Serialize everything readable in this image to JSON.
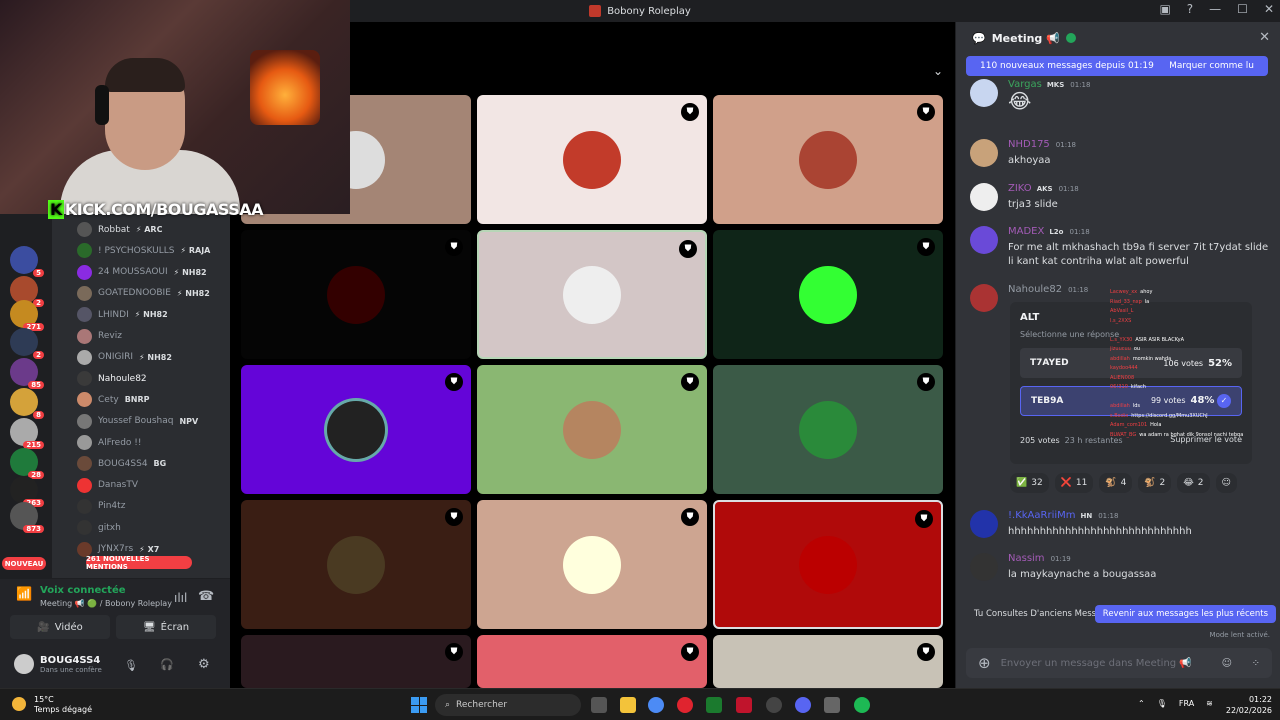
{
  "window": {
    "title": "Bobony Roleplay"
  },
  "overlay_text": {
    "kick": "KICK.COM/BOUGASSAA",
    "kick_letter": "K"
  },
  "servers": {
    "badges": [
      "5",
      "2",
      "271",
      "2",
      "85",
      "8",
      "215",
      "28",
      "263",
      "873"
    ],
    "nouveau": "NOUVEAU"
  },
  "members": [
    {
      "name": "Robbat",
      "tag": "⚡ ARC",
      "color": "#dbdee1"
    },
    {
      "name": "! PSYCHOSKULLS",
      "tag": "⚡ RAJA",
      "color": "#949ba4"
    },
    {
      "name": "24 MOUSSAOUI",
      "tag": "⚡ NH82",
      "color": "#949ba4"
    },
    {
      "name": "GOATEDNOOBIE",
      "tag": "⚡ NH82",
      "color": "#949ba4"
    },
    {
      "name": "LHINDI",
      "tag": "⚡ NH82",
      "color": "#949ba4"
    },
    {
      "name": "Reviz",
      "tag": "",
      "color": "#949ba4"
    },
    {
      "name": "ONIGIRI",
      "tag": "⚡ NH82",
      "color": "#949ba4"
    },
    {
      "name": "Nahoule82",
      "tag": "",
      "color": "#f2f3f5"
    },
    {
      "name": "Cety",
      "tag": "BNRP",
      "color": "#949ba4"
    },
    {
      "name": "Youssef Boushaq",
      "tag": "NPV",
      "color": "#949ba4"
    },
    {
      "name": "AlFredo !!",
      "tag": "",
      "color": "#949ba4"
    },
    {
      "name": "BOUG4SS4",
      "tag": "BG",
      "color": "#949ba4"
    },
    {
      "name": "DanasTV",
      "tag": "",
      "color": "#949ba4"
    },
    {
      "name": "Pin4tz",
      "tag": "",
      "color": "#949ba4"
    },
    {
      "name": "gitxh",
      "tag": "",
      "color": "#949ba4"
    },
    {
      "name": "JYNX7rs",
      "tag": "⚡ X7",
      "color": "#949ba4"
    }
  ],
  "mentions": "261 NOUVELLES MENTIONS",
  "voice": {
    "status": "Voix connectée",
    "channel": "Meeting 📢 🟢 / Bobony Roleplay",
    "video_label": "Vidéo",
    "screen_label": "Écran",
    "user_name": "BOUG4SS4",
    "user_status": "Dans une confère"
  },
  "tiles_colors": [
    "#a48575",
    "#f2e6e4",
    "#d0a08a",
    "#050505",
    "#d3c6c6",
    "#0f2518",
    "#6405d8",
    "#8ab772",
    "#3b5a47",
    "#3a1e14",
    "#cda591",
    "#b00a0a",
    "#2a1a1f",
    "#e2606a",
    "#c8c2b6"
  ],
  "chat": {
    "channel": "Meeting 📢",
    "new_messages": "110 nouveaux messages depuis 01:19",
    "mark_read": "Marquer comme lu",
    "messages": [
      {
        "author": "Vargas",
        "badge": "MKS",
        "time": "01:18",
        "text": "😂",
        "color": "#3ba55d"
      },
      {
        "author": "NHD175",
        "badge": "",
        "time": "01:18",
        "text": "akhoyaa",
        "color": "#a35bb6"
      },
      {
        "author": "ZIKO",
        "badge": "AKS",
        "time": "01:18",
        "text": "trja3 slide",
        "color": "#a35bb6"
      },
      {
        "author": "MADEX",
        "badge": "L2o",
        "time": "01:18",
        "text": "For me alt mkhashach tb9a fi server 7it t7ydat slide li kant kat contriha wlat alt powerful",
        "color": "#a35bb6"
      },
      {
        "author": "Nahoule82",
        "badge": "",
        "time": "01:18",
        "text": "",
        "color": "#949ba4"
      },
      {
        "author": "!.KkAaRriiMm",
        "badge": "HN",
        "time": "01:18",
        "text": "hhhhhhhhhhhhhhhhhhhhhhhhhhhhh",
        "color": "#5865f2"
      },
      {
        "author": "Nassim",
        "badge": "",
        "time": "01:19",
        "text": "la maykaynache a bougassaa",
        "color": "#a35bb6"
      }
    ],
    "poll": {
      "question": "ALT",
      "hint": "Sélectionne une réponse",
      "options": [
        {
          "label": "T7AYED",
          "votes": "106 votes",
          "pct": "52%"
        },
        {
          "label": "TEB9A",
          "votes": "99 votes",
          "pct": "48%"
        }
      ],
      "total": "205 votes",
      "remaining": "23 h restantes",
      "delete": "Supprimer le vote"
    },
    "reactions": [
      {
        "emoji": "✅",
        "count": "32"
      },
      {
        "emoji": "❌",
        "count": "11"
      },
      {
        "emoji": "🐒",
        "count": "4"
      },
      {
        "emoji": "🐒",
        "count": "2"
      },
      {
        "emoji": "😂",
        "count": "2"
      }
    ],
    "old_messages": "Tu Consultes D'anciens Messages",
    "back_recent": "Revenir aux messages les plus récents",
    "slow_mode": "Mode lent activé.",
    "input_placeholder": "Envoyer un message dans Meeting 📢"
  },
  "overlay_chat": [
    {
      "user": "Lacwey_xx",
      "text": "ahoy"
    },
    {
      "user": "Riad_33_nxp",
      "text": "la"
    },
    {
      "user": "AbVasil_L",
      "text": ""
    },
    {
      "user": "l.s_2XXS",
      "text": ""
    },
    {
      "user": "",
      "text": ""
    },
    {
      "user": "L.s_YX30",
      "text": "ASIR ASIR BLACKyA"
    },
    {
      "user": "jizuucuu",
      "text": "ou"
    },
    {
      "user": "abdillah",
      "text": "momkin wahda"
    },
    {
      "user": "kaydoo444",
      "text": ""
    },
    {
      "user": "ALIEN008",
      "text": ""
    },
    {
      "user": "06!310",
      "text": "kifach"
    },
    {
      "user": "",
      "text": ""
    },
    {
      "user": "abdillah",
      "text": "lds"
    },
    {
      "user": "s.Bodix",
      "text": "https://discord.gg/Mmu3XUChJ"
    },
    {
      "user": "Adam_com101",
      "text": "Hola"
    },
    {
      "user": "BLWAT_BG",
      "text": "wa adam ra bghat dik 9onsol nachi tebqa"
    }
  ],
  "taskbar": {
    "temp": "15°C",
    "weather": "Temps dégagé",
    "search": "Rechercher",
    "lang": "FRA",
    "time": "01:22",
    "date": "22/02/2026"
  }
}
